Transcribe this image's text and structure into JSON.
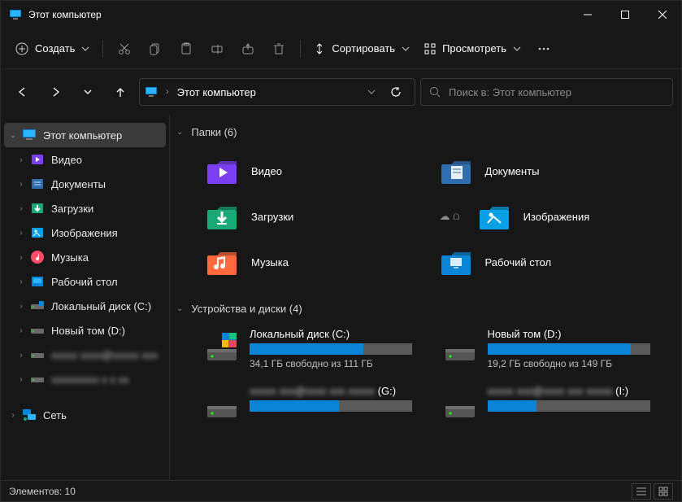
{
  "title": "Этот компьютер",
  "toolbar": {
    "new_label": "Создать",
    "sort_label": "Сортировать",
    "view_label": "Просмотреть"
  },
  "breadcrumb": {
    "root": "Этот компьютер"
  },
  "search": {
    "placeholder": "Поиск в: Этот компьютер"
  },
  "sidebar": {
    "this_pc": "Этот компьютер",
    "items": [
      {
        "label": "Видео"
      },
      {
        "label": "Документы"
      },
      {
        "label": "Загрузки"
      },
      {
        "label": "Изображения"
      },
      {
        "label": "Музыка"
      },
      {
        "label": "Рабочий стол"
      },
      {
        "label": "Локальный диск (C:)"
      },
      {
        "label": "Новый том (D:)"
      }
    ],
    "network": "Сеть"
  },
  "groups": {
    "folders": {
      "title": "Папки (6)"
    },
    "drives": {
      "title": "Устройства и диски (4)"
    }
  },
  "folders": [
    {
      "label": "Видео",
      "color": "#7b3ff2",
      "dot": true
    },
    {
      "label": "Документы",
      "color": "#2f6fb0",
      "dot": false
    },
    {
      "label": "Загрузки",
      "color": "#19a974",
      "dot": false
    },
    {
      "label": "Изображения",
      "color": "#0aa0e6",
      "dot": false,
      "shared": true
    },
    {
      "label": "Музыка",
      "color": "#ff6a3d",
      "dot": false
    },
    {
      "label": "Рабочий стол",
      "color": "#0a84d6",
      "dot": false
    }
  ],
  "drives": [
    {
      "name": "Локальный диск (C:)",
      "free": "34,1 ГБ свободно из 111 ГБ",
      "fill": 70,
      "os": true
    },
    {
      "name": "Новый том (D:)",
      "free": "19,2 ГБ свободно из 149 ГБ",
      "fill": 88
    },
    {
      "name": "(G:)",
      "free": "",
      "fill": 55,
      "blurname": true
    },
    {
      "name": "(I:)",
      "free": "",
      "fill": 30,
      "blurname": true
    }
  ],
  "status": {
    "items": "Элементов: 10"
  }
}
